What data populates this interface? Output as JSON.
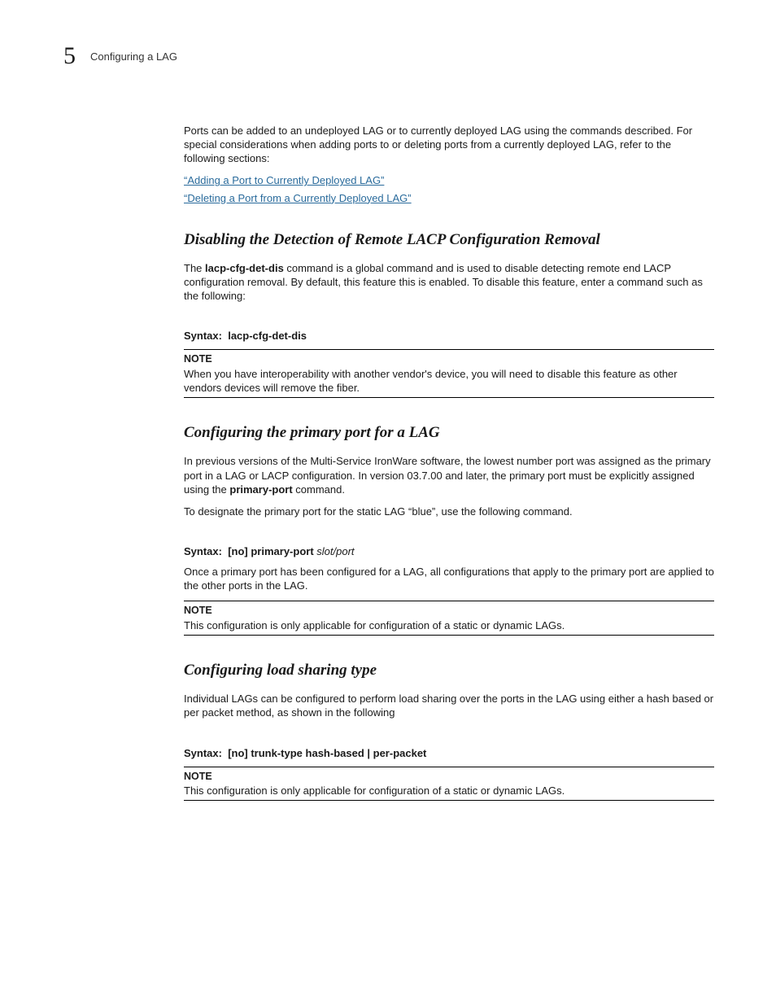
{
  "header": {
    "chapter_number": "5",
    "chapter_title": "Configuring a LAG"
  },
  "intro": {
    "paragraph": "Ports can be added to an undeployed LAG or to currently deployed LAG using the commands described. For special considerations when adding ports to or deleting ports from a currently deployed LAG, refer to the following sections:",
    "xref1": "“Adding a Port to Currently Deployed LAG”",
    "xref2": "“Deleting a Port from a Currently Deployed LAG”"
  },
  "s1": {
    "heading": "Disabling the Detection of Remote LACP Configuration Removal",
    "p1_a": "The ",
    "p1_cmd": "lacp-cfg-det-dis",
    "p1_b": " command is a global command and is used to disable detecting remote end LACP configuration removal. By default, this feature this is enabled. To disable this feature, enter a command such as the following:",
    "syntax_label": "Syntax:",
    "syntax_cmd": "lacp-cfg-det-dis",
    "note_label": "NOTE",
    "note_text": "When you have interoperability with another vendor's device, you will need to disable this feature as other vendors devices will remove the fiber."
  },
  "s2": {
    "heading": "Configuring the primary port for a LAG",
    "p1_a": "In previous versions of the Multi-Service IronWare software, the lowest number port was assigned as the primary port in a LAG or LACP configuration. In version 03.7.00 and later, the primary port must be explicitly assigned using the ",
    "p1_cmd": "primary-port",
    "p1_b": " command.",
    "p2": "To designate the primary port for the static LAG “blue”, use the following command.",
    "syntax_label": "Syntax:",
    "syntax_cmd": "[no] primary-port",
    "syntax_arg": "slot/port",
    "p3": "Once a primary port has been configured for a LAG, all configurations that apply to the primary port are applied to the other ports in the LAG.",
    "note_label": "NOTE",
    "note_text": "This configuration is only applicable for configuration of a static or dynamic LAGs."
  },
  "s3": {
    "heading": "Configuring load sharing type",
    "p1": "Individual LAGs can be configured to perform load sharing over the ports in the LAG using either a hash based or per packet method, as shown in the following",
    "syntax_label": "Syntax:",
    "syntax_cmd": "[no] trunk-type hash-based | per-packet",
    "note_label": "NOTE",
    "note_text": "This configuration is only applicable for configuration of a static or dynamic LAGs."
  }
}
